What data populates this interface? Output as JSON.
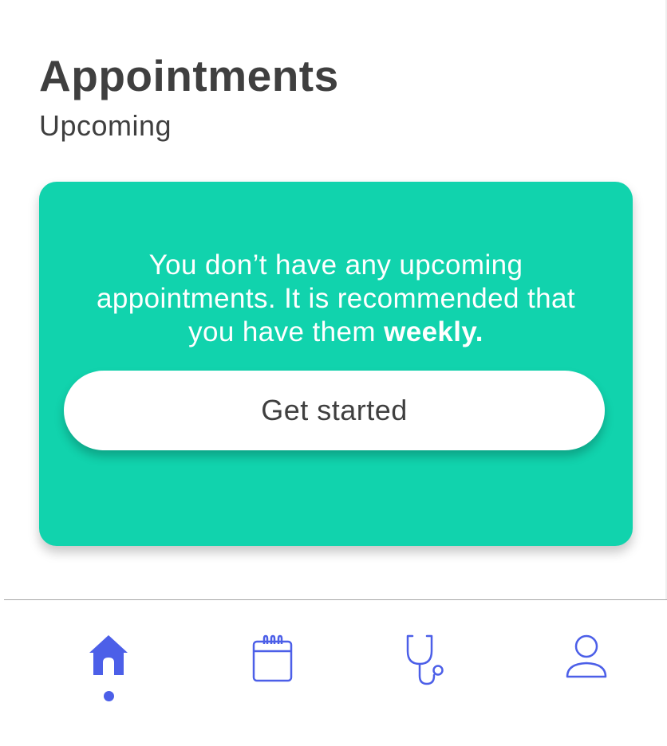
{
  "header": {
    "title": "Appointments",
    "section": "Upcoming"
  },
  "card": {
    "message_prefix": "You don’t have any upcoming appointments. It is recommended that you have them ",
    "message_emphasis": "weekly.",
    "button_label": "Get started",
    "background_color": "#11d3ad"
  },
  "tabbar": {
    "accent_color": "#4c5fe8",
    "active_tab": "home",
    "tabs": [
      {
        "id": "home",
        "icon": "home-icon",
        "active": true
      },
      {
        "id": "calendar",
        "icon": "calendar-icon",
        "active": false
      },
      {
        "id": "doctor",
        "icon": "stethoscope-icon",
        "active": false
      },
      {
        "id": "profile",
        "icon": "profile-icon",
        "active": false
      }
    ]
  }
}
